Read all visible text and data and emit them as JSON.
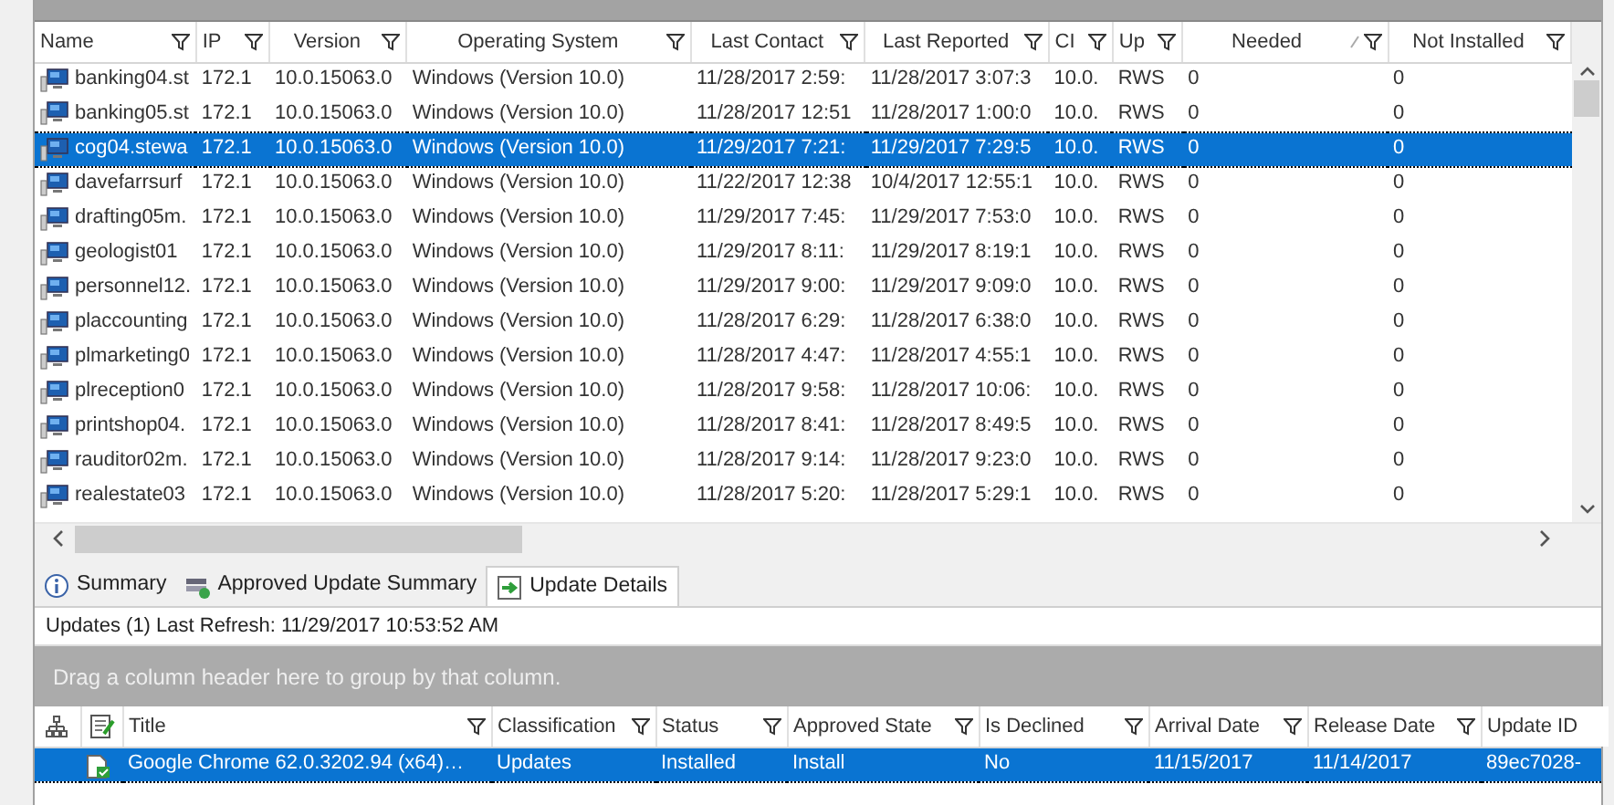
{
  "computers": {
    "columns": [
      {
        "label": "Name",
        "filter": true
      },
      {
        "label": "IP",
        "filter": true
      },
      {
        "label": "Version",
        "filter": true
      },
      {
        "label": "Operating System",
        "filter": true
      },
      {
        "label": "Last Contact",
        "filter": true
      },
      {
        "label": "Last Reported",
        "filter": true
      },
      {
        "label": "CI",
        "filter": true
      },
      {
        "label": "Up",
        "filter": true
      },
      {
        "label": "Needed",
        "filter": true,
        "sorted": true
      },
      {
        "label": "Not Installed",
        "filter": true
      }
    ],
    "rows": [
      {
        "cells": [
          "banking04.st",
          "172.1",
          "10.0.15063.0",
          "Windows (Version 10.0)",
          "11/28/2017 2:59:",
          "11/28/2017 3:07:3",
          "10.0.",
          "RWS",
          "0",
          "0"
        ],
        "selected": false
      },
      {
        "cells": [
          "banking05.st",
          "172.1",
          "10.0.15063.0",
          "Windows (Version 10.0)",
          "11/28/2017 12:51",
          "11/28/2017 1:00:0",
          "10.0.",
          "RWS",
          "0",
          "0"
        ],
        "selected": false
      },
      {
        "cells": [
          "cog04.stewa",
          "172.1",
          "10.0.15063.0",
          "Windows (Version 10.0)",
          "11/29/2017 7:21:",
          "11/29/2017 7:29:5",
          "10.0.",
          "RWS",
          "0",
          "0"
        ],
        "selected": true
      },
      {
        "cells": [
          "davefarrsurf",
          "172.1",
          "10.0.15063.0",
          "Windows (Version 10.0)",
          "11/22/2017 12:38",
          "10/4/2017 12:55:1",
          "10.0.",
          "RWS",
          "0",
          "0"
        ],
        "selected": false
      },
      {
        "cells": [
          "drafting05m.",
          "172.1",
          "10.0.15063.0",
          "Windows (Version 10.0)",
          "11/29/2017 7:45:",
          "11/29/2017 7:53:0",
          "10.0.",
          "RWS",
          "0",
          "0"
        ],
        "selected": false
      },
      {
        "cells": [
          "geologist01",
          "172.1",
          "10.0.15063.0",
          "Windows (Version 10.0)",
          "11/29/2017 8:11:",
          "11/29/2017 8:19:1",
          "10.0.",
          "RWS",
          "0",
          "0"
        ],
        "selected": false
      },
      {
        "cells": [
          "personnel12.",
          "172.1",
          "10.0.15063.0",
          "Windows (Version 10.0)",
          "11/29/2017 9:00:",
          "11/29/2017 9:09:0",
          "10.0.",
          "RWS",
          "0",
          "0"
        ],
        "selected": false
      },
      {
        "cells": [
          "placcounting",
          "172.1",
          "10.0.15063.0",
          "Windows (Version 10.0)",
          "11/28/2017 6:29:",
          "11/28/2017 6:38:0",
          "10.0.",
          "RWS",
          "0",
          "0"
        ],
        "selected": false
      },
      {
        "cells": [
          "plmarketing0",
          "172.1",
          "10.0.15063.0",
          "Windows (Version 10.0)",
          "11/28/2017 4:47:",
          "11/28/2017 4:55:1",
          "10.0.",
          "RWS",
          "0",
          "0"
        ],
        "selected": false
      },
      {
        "cells": [
          "plreception0",
          "172.1",
          "10.0.15063.0",
          "Windows (Version 10.0)",
          "11/28/2017 9:58:",
          "11/28/2017 10:06:",
          "10.0.",
          "RWS",
          "0",
          "0"
        ],
        "selected": false
      },
      {
        "cells": [
          "printshop04.",
          "172.1",
          "10.0.15063.0",
          "Windows (Version 10.0)",
          "11/28/2017 8:41:",
          "11/28/2017 8:49:5",
          "10.0.",
          "RWS",
          "0",
          "0"
        ],
        "selected": false
      },
      {
        "cells": [
          "rauditor02m.",
          "172.1",
          "10.0.15063.0",
          "Windows (Version 10.0)",
          "11/28/2017 9:14:",
          "11/28/2017 9:23:0",
          "10.0.",
          "RWS",
          "0",
          "0"
        ],
        "selected": false
      },
      {
        "cells": [
          "realestate03",
          "172.1",
          "10.0.15063.0",
          "Windows (Version 10.0)",
          "11/28/2017 5:20:",
          "11/28/2017 5:29:1",
          "10.0.",
          "RWS",
          "0",
          "0"
        ],
        "selected": false
      }
    ]
  },
  "tabs": [
    {
      "label": "Summary",
      "selected": false
    },
    {
      "label": "Approved Update Summary",
      "selected": false
    },
    {
      "label": "Update Details",
      "selected": true
    }
  ],
  "refresh_info": "Updates (1) Last Refresh: 11/29/2017 10:53:52 AM",
  "group_hint": "Drag a column header here to group by that column.",
  "updates": {
    "columns": [
      {
        "label": "Title",
        "filter": true
      },
      {
        "label": "Classification",
        "filter": true
      },
      {
        "label": "Status",
        "filter": true
      },
      {
        "label": "Approved State",
        "filter": true
      },
      {
        "label": "Is Declined",
        "filter": true
      },
      {
        "label": "Arrival Date",
        "filter": true
      },
      {
        "label": "Release Date",
        "filter": true
      },
      {
        "label": "Update ID",
        "filter": false
      }
    ],
    "rows": [
      {
        "cells": [
          "Google Chrome 62.0.3202.94 (x64)…",
          "Updates",
          "Installed",
          "Install",
          "No",
          "11/15/2017",
          "11/14/2017",
          "89ec7028-"
        ],
        "selected": true
      }
    ]
  }
}
